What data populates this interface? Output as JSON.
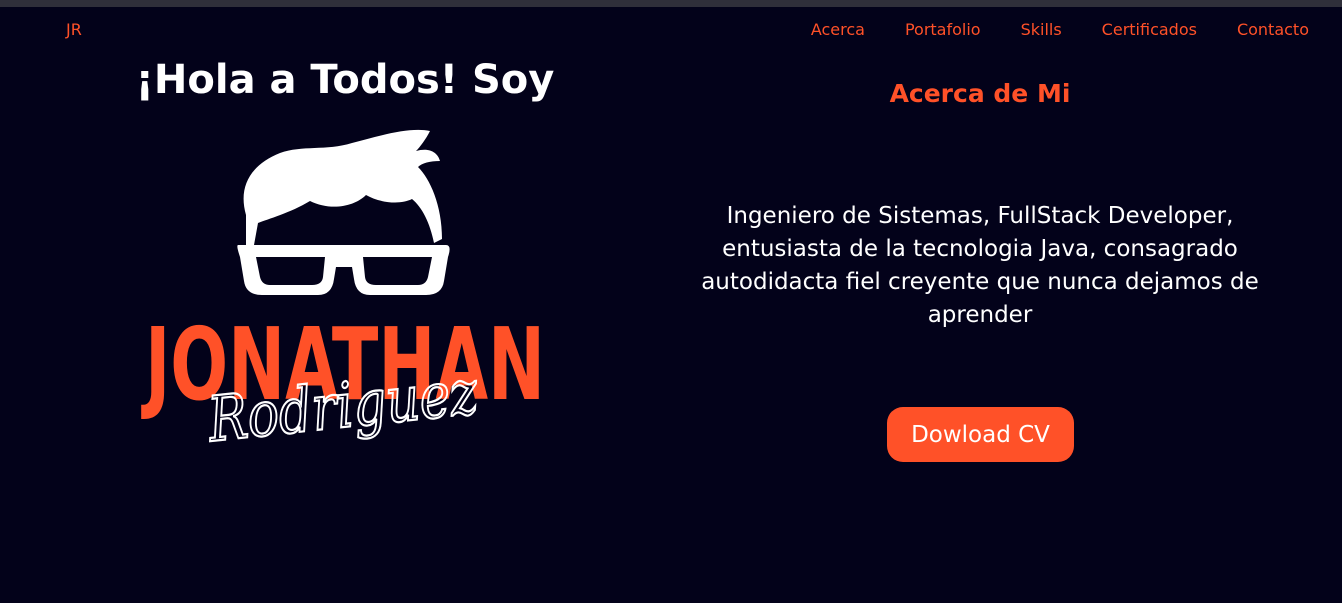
{
  "nav": {
    "brand": "JR",
    "links": [
      "Acerca",
      "Portafolio",
      "Skills",
      "Certificados",
      "Contacto"
    ]
  },
  "hero": {
    "greeting": "¡Hola a Todos! Soy",
    "logo": {
      "first_name": "JONATHAN",
      "last_name": "Rodriguez"
    }
  },
  "about": {
    "title": "Acerca de Mi",
    "text": "Ingeniero de Sistemas, FullStack Developer, entusiasta de la tecnologia Java, consagrado autodidacta fiel creyente que nunca dejamos de aprender",
    "button_label": "Dowload CV"
  },
  "colors": {
    "background": "#03021a",
    "accent": "#ff5128",
    "text": "#ffffff"
  }
}
